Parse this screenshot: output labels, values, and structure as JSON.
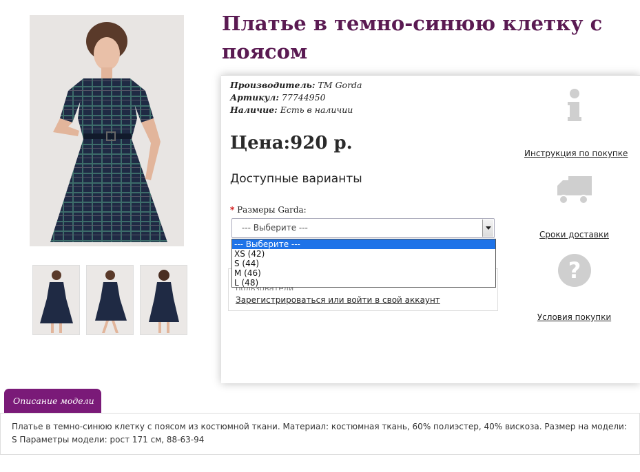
{
  "product": {
    "title": "Платье в темно-синюю клетку с поясом",
    "manufacturer_label": "Производитель:",
    "manufacturer_value": "TM Gorda",
    "article_label": "Артикул:",
    "article_value": "77744950",
    "availability_label": "Наличие:",
    "availability_value": "Есть в наличии",
    "price": "Цена:920 р."
  },
  "variants": {
    "title": "Доступные варианты",
    "required_mark": "*",
    "size_label": "Размеры Garda:",
    "selected": "--- Выберите ---",
    "options": [
      "--- Выберите ---",
      "XS (42)",
      "S (44)",
      "M (46)",
      "L (48)"
    ]
  },
  "login": {
    "partial_text": "пользователи",
    "link": "Зарегистрироваться или войти в свой аккаунт"
  },
  "sidebar": {
    "instruction": "Инструкция по покупке",
    "delivery": "Сроки доставки",
    "terms": "Условия покупки"
  },
  "description": {
    "tab_label": "Описание модели",
    "text": "Платье в темно-синюю клетку с поясом из костюмной ткани. Материал: костюмная ткань, 60% полиэстер, 40% вискоза. Размер на модели: S Параметры модели: рост 171 см, 88-63-94"
  },
  "colors": {
    "title": "#5a1a52",
    "tab": "#7a1a78",
    "selection": "#1e73e8"
  }
}
